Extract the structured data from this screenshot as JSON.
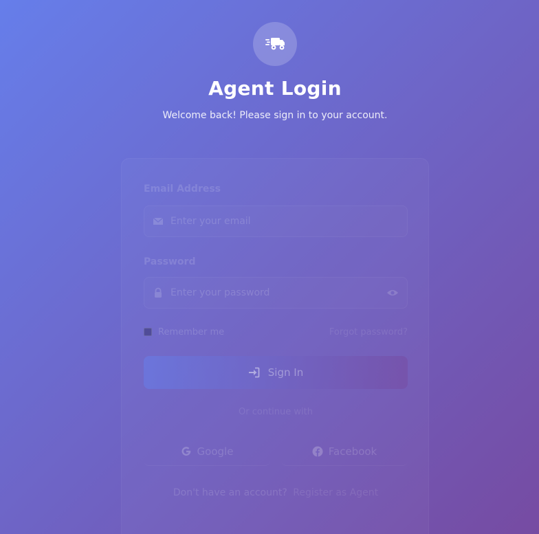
{
  "header": {
    "logo_icon": "truck-fast-icon",
    "title": "Agent Login",
    "subtitle": "Welcome back! Please sign in to your account."
  },
  "form": {
    "email": {
      "label": "Email Address",
      "placeholder": "Enter your email",
      "icon": "envelope-icon"
    },
    "password": {
      "label": "Password",
      "placeholder": "Enter your password",
      "icon": "lock-icon",
      "toggle_icon": "eye-icon"
    },
    "remember_label": "Remember me",
    "forgot_label": "Forgot password?",
    "submit_label": "Sign In",
    "submit_icon": "sign-in-icon"
  },
  "social": {
    "divider": "Or continue with",
    "google_label": "Google",
    "facebook_label": "Facebook"
  },
  "footer": {
    "prompt": "Don't have an account?",
    "register_label": "Register as Agent"
  },
  "colors": {
    "gradient_start": "#667eea",
    "gradient_end": "#764ba2"
  }
}
